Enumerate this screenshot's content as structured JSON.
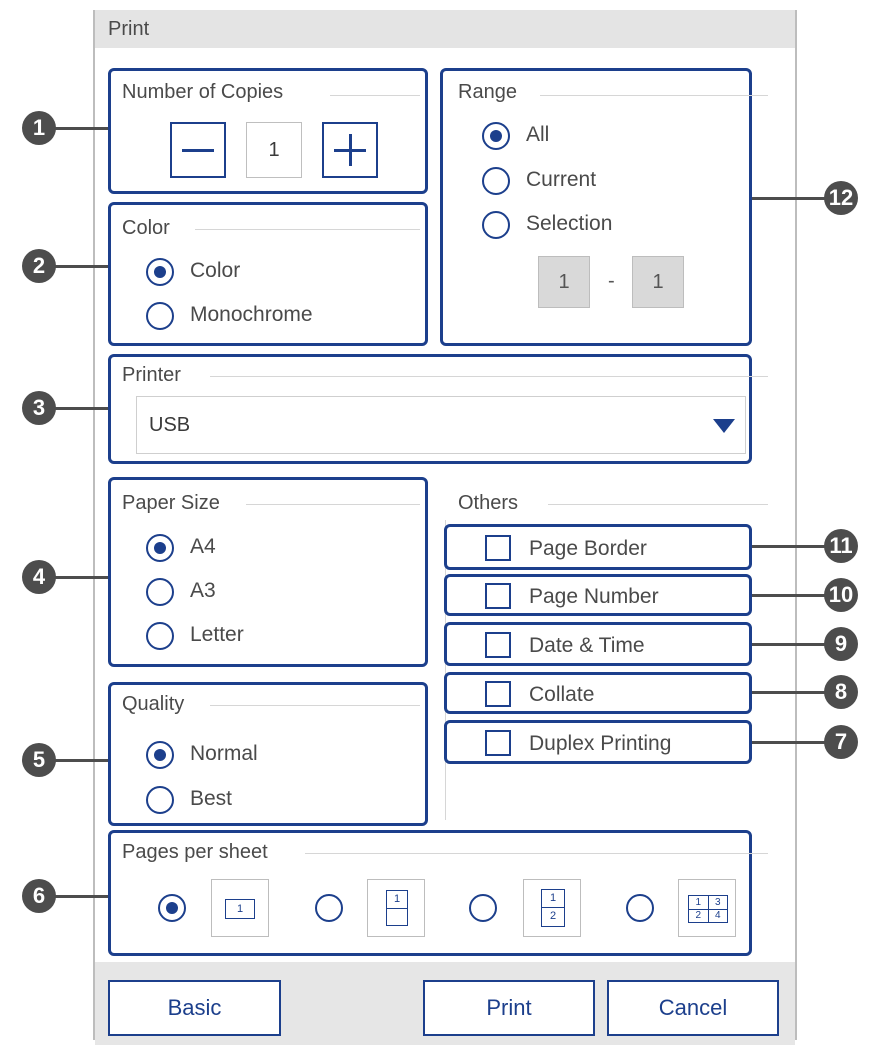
{
  "title": "Print",
  "copies": {
    "label": "Number of Copies",
    "value": "1",
    "minus": "—",
    "plus": "+"
  },
  "color": {
    "label": "Color",
    "options": [
      "Color",
      "Monochrome"
    ],
    "selected": "Color"
  },
  "range": {
    "label": "Range",
    "options": [
      "All",
      "Current",
      "Selection"
    ],
    "selected": "All",
    "from": "1",
    "separator": "-",
    "to": "1"
  },
  "printer": {
    "label": "Printer",
    "value": "USB"
  },
  "paper": {
    "label": "Paper Size",
    "options": [
      "A4",
      "A3",
      "Letter"
    ],
    "selected": "A4"
  },
  "quality": {
    "label": "Quality",
    "options": [
      "Normal",
      "Best"
    ],
    "selected": "Normal"
  },
  "others": {
    "label": "Others",
    "items": [
      "Page Border",
      "Page Number",
      "Date & Time",
      "Collate",
      "Duplex Printing"
    ]
  },
  "pages_per_sheet": {
    "label": "Pages per sheet",
    "options": [
      "1",
      "2",
      "2",
      "4"
    ],
    "selected": 0,
    "icons": {
      "one": "1",
      "two_top": "1",
      "two_a": "1",
      "two_b": "2",
      "q1": "1",
      "q2": "3",
      "q3": "2",
      "q4": "4"
    }
  },
  "buttons": {
    "basic": "Basic",
    "print": "Print",
    "cancel": "Cancel"
  },
  "callouts": [
    "1",
    "2",
    "3",
    "4",
    "5",
    "6",
    "7",
    "8",
    "9",
    "10",
    "11",
    "12"
  ],
  "colors": {
    "accent": "#1c3f8c",
    "callout": "#4d4d4d",
    "titlebar": "#e4e4e4"
  }
}
